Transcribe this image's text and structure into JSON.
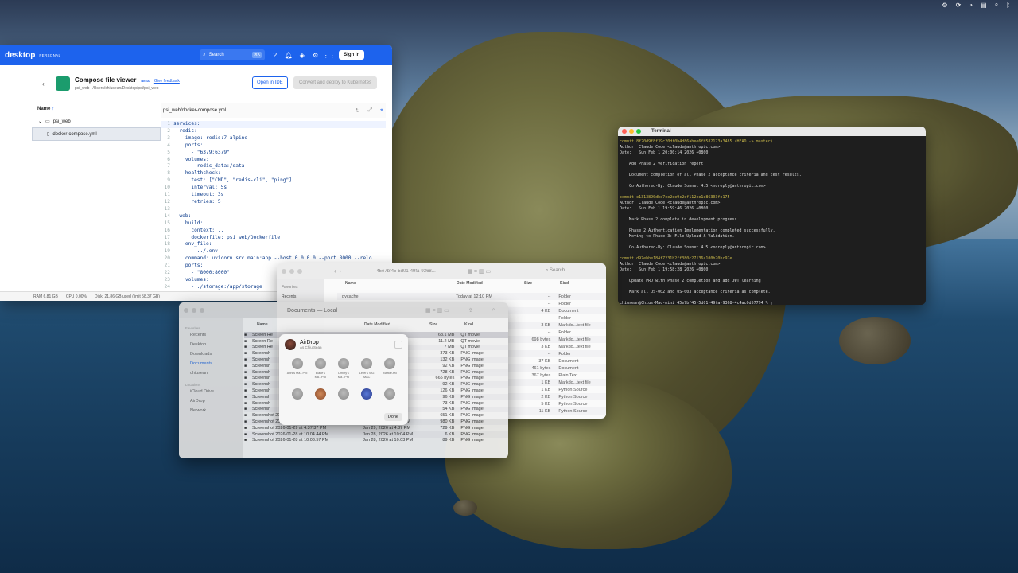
{
  "menubar": {
    "icons": [
      "gear-icon",
      "sync-icon",
      "wifi-icon",
      "control-center-icon",
      "search-icon",
      "bluetooth-icon"
    ]
  },
  "docker": {
    "brand": "desktop",
    "plan": "PERSONAL",
    "search_placeholder": "Search",
    "search_kbd": "⌘K",
    "signin_label": "Sign in",
    "page_title": "Compose file viewer",
    "beta": "BETA",
    "feedback": "Give feedback",
    "path": "psi_web | /Users/chiusean/Desktop/psi/psi_web",
    "open_ide": "Open in IDE",
    "deploy": "Convert and deploy to Kubernetes",
    "tree_header": "Name",
    "tree_folder": "psi_web",
    "tree_file": "docker-compose.yml",
    "editor_path": "psi_web/docker-compose.yml",
    "status": {
      "ram": "RAM 6.81 GB",
      "cpu": "CPU 0.00%",
      "disk": "Disk: 21.86 GB used (limit 58.37 GB)"
    },
    "code": [
      {
        "n": "1",
        "t": "services:"
      },
      {
        "n": "2",
        "t": "  redis:"
      },
      {
        "n": "3",
        "t": "    image: redis:7-alpine"
      },
      {
        "n": "4",
        "t": "    ports:"
      },
      {
        "n": "5",
        "t": "      - \"6379:6379\""
      },
      {
        "n": "6",
        "t": "    volumes:"
      },
      {
        "n": "7",
        "t": "      - redis_data:/data"
      },
      {
        "n": "8",
        "t": "    healthcheck:"
      },
      {
        "n": "9",
        "t": "      test: [\"CMD\", \"redis-cli\", \"ping\"]"
      },
      {
        "n": "10",
        "t": "      interval: 5s"
      },
      {
        "n": "11",
        "t": "      timeout: 3s"
      },
      {
        "n": "12",
        "t": "      retries: 5"
      },
      {
        "n": "13",
        "t": ""
      },
      {
        "n": "14",
        "t": "  web:"
      },
      {
        "n": "15",
        "t": "    build:"
      },
      {
        "n": "16",
        "t": "      context: .."
      },
      {
        "n": "17",
        "t": "      dockerfile: psi_web/Dockerfile"
      },
      {
        "n": "18",
        "t": "    env_file:"
      },
      {
        "n": "19",
        "t": "      - ../.env"
      },
      {
        "n": "20",
        "t": "    command: uvicorn src.main:app --host 0.0.0.0 --port 8000 --relo"
      },
      {
        "n": "21",
        "t": "    ports:"
      },
      {
        "n": "22",
        "t": "      - \"8000:8000\""
      },
      {
        "n": "23",
        "t": "    volumes:"
      },
      {
        "n": "24",
        "t": "      - ./storage:/app/storage"
      }
    ]
  },
  "terminal": {
    "title": "Terminal",
    "lines": [
      {
        "t": "commit 8f20d9f8f39c20df0b4d86abee6fb582123a3485 (HEAD -> master)",
        "c": "commit"
      },
      {
        "t": "Author: Claude Code <claude@anthropic.com>",
        "c": ""
      },
      {
        "t": "Date:   Sun Feb 1 20:00:14 2026 +0800",
        "c": ""
      },
      {
        "t": "",
        "c": ""
      },
      {
        "t": "    Add Phase 2 verification report",
        "c": ""
      },
      {
        "t": "",
        "c": ""
      },
      {
        "t": "    Document completion of all Phase 2 acceptance criteria and test results.",
        "c": ""
      },
      {
        "t": "",
        "c": ""
      },
      {
        "t": "    Co-Authored-By: Claude Sonnet 4.5 <noreply@anthropic.com>",
        "c": ""
      },
      {
        "t": "",
        "c": ""
      },
      {
        "t": "commit e1313890dbe7ee2ee9c2ef112ee1e86303fe175",
        "c": "commit"
      },
      {
        "t": "Author: Claude Code <claude@anthropic.com>",
        "c": ""
      },
      {
        "t": "Date:   Sun Feb 1 19:59:46 2026 +0800",
        "c": ""
      },
      {
        "t": "",
        "c": ""
      },
      {
        "t": "    Mark Phase 2 complete in development progress",
        "c": ""
      },
      {
        "t": "",
        "c": ""
      },
      {
        "t": "    Phase 2 Authentication Implementation completed successfully.",
        "c": ""
      },
      {
        "t": "    Moving to Phase 3: File Upload & Validation.",
        "c": ""
      },
      {
        "t": "",
        "c": ""
      },
      {
        "t": "    Co-Authored-By: Claude Sonnet 4.5 <noreply@anthropic.com>",
        "c": ""
      },
      {
        "t": "",
        "c": ""
      },
      {
        "t": "commit d97ebbe184f7231b2ff380c27136a100b20bc97e",
        "c": "commit"
      },
      {
        "t": "Author: Claude Code <claude@anthropic.com>",
        "c": ""
      },
      {
        "t": "Date:   Sun Feb 1 19:58:28 2026 +0800",
        "c": ""
      },
      {
        "t": "",
        "c": ""
      },
      {
        "t": "    Update PRD with Phase 2 completion and add JWT learning",
        "c": ""
      },
      {
        "t": "",
        "c": ""
      },
      {
        "t": "    Mark all US-002 and US-003 acceptance criteria as complete.",
        "c": ""
      },
      {
        "t": "",
        "c": ""
      },
      {
        "t": "chiusean@Chius-Mac-mini 45e7bf45-5d01-49fa-9368-4c4ac0d57794 % ▯",
        "c": ""
      }
    ]
  },
  "finder_back": {
    "title": "45e7bf45-5d01-49fa-9368...",
    "search": "Search",
    "sidebar": [
      "Favorites",
      "Recents"
    ],
    "columns": [
      "Name",
      "Date Modified",
      "Size",
      "Kind"
    ],
    "rows": [
      {
        "name": "__pycache__",
        "date": "Today at 12:10 PM",
        "size": "--",
        "kind": "Folder"
      },
      {
        "name": "",
        "date": "",
        "size": "--",
        "kind": "Folder"
      },
      {
        "name": "",
        "date": "",
        "size": "4 KB",
        "kind": "Document"
      },
      {
        "name": "",
        "date": "",
        "size": "--",
        "kind": "Folder"
      },
      {
        "name": "",
        "date": "",
        "size": "3 KB",
        "kind": "Markdo...text file"
      },
      {
        "name": "",
        "date": "",
        "size": "--",
        "kind": "Folder"
      },
      {
        "name": "",
        "date": "",
        "size": "698 bytes",
        "kind": "Markdo...text file"
      },
      {
        "name": "",
        "date": "",
        "size": "3 KB",
        "kind": "Markdo...text file"
      },
      {
        "name": "",
        "date": "",
        "size": "--",
        "kind": "Folder"
      },
      {
        "name": "",
        "date": "",
        "size": "37 KB",
        "kind": "Document"
      },
      {
        "name": "",
        "date": "",
        "size": "461 bytes",
        "kind": "Document"
      },
      {
        "name": "",
        "date": "",
        "size": "367 bytes",
        "kind": "Plain Text"
      },
      {
        "name": "",
        "date": "",
        "size": "1 KB",
        "kind": "Markdo...text file"
      },
      {
        "name": "",
        "date": "",
        "size": "1 KB",
        "kind": "Python Source"
      },
      {
        "name": "",
        "date": "",
        "size": "2 KB",
        "kind": "Python Source"
      },
      {
        "name": "",
        "date": "",
        "size": "5 KB",
        "kind": "Python Source"
      },
      {
        "name": "",
        "date": "",
        "size": "11 KB",
        "kind": "Python Source"
      }
    ]
  },
  "finder_front": {
    "title": "Documents — Local",
    "sidebar": {
      "favorites_label": "Favorites",
      "favorites": [
        "Recents",
        "Desktop",
        "Downloads",
        "Documents",
        "chiusean"
      ],
      "locations_label": "Locations",
      "locations": [
        "iCloud Drive",
        "AirDrop",
        "Network"
      ]
    },
    "columns": [
      "Name",
      "Date Modified",
      "Size",
      "Kind"
    ],
    "rows": [
      {
        "name": "Screen Re",
        "date": "",
        "size": "63.1 MB",
        "kind": "QT movie"
      },
      {
        "name": "Screen Re",
        "date": "",
        "size": "11.2 MB",
        "kind": "QT movie"
      },
      {
        "name": "Screen Re",
        "date": "",
        "size": "7 MB",
        "kind": "QT movie"
      },
      {
        "name": "Screensh",
        "date": "",
        "size": "373 KB",
        "kind": "PNG image"
      },
      {
        "name": "Screensh",
        "date": "",
        "size": "132 KB",
        "kind": "PNG image"
      },
      {
        "name": "Screensh",
        "date": "",
        "size": "92 KB",
        "kind": "PNG image"
      },
      {
        "name": "Screensh",
        "date": "",
        "size": "728 KB",
        "kind": "PNG image"
      },
      {
        "name": "Screensh",
        "date": "",
        "size": "665 bytes",
        "kind": "PNG image"
      },
      {
        "name": "Screensh",
        "date": "",
        "size": "92 KB",
        "kind": "PNG image"
      },
      {
        "name": "Screensh",
        "date": "",
        "size": "126 KB",
        "kind": "PNG image"
      },
      {
        "name": "Screensh",
        "date": "",
        "size": "96 KB",
        "kind": "PNG image"
      },
      {
        "name": "Screensh",
        "date": "",
        "size": "73 KB",
        "kind": "PNG image"
      },
      {
        "name": "Screensh",
        "date": "",
        "size": "54 KB",
        "kind": "PNG image"
      },
      {
        "name": "Screenshot 2026-01-31 at 2.46.05 PM",
        "date": "Yesterday at 2:46 PM",
        "size": "651 KB",
        "kind": "PNG image"
      },
      {
        "name": "Screenshot 2026-01-29 at 8.18.54 PM",
        "date": "Jan 29, 2026 at 8:19 PM",
        "size": "980 KB",
        "kind": "PNG image"
      },
      {
        "name": "Screenshot 2026-01-29 at 4.37.37 PM",
        "date": "Jan 29, 2026 at 4:37 PM",
        "size": "729 KB",
        "kind": "PNG image"
      },
      {
        "name": "Screenshot 2026-01-28 at 10.04.44 PM",
        "date": "Jan 28, 2026 at 10:04 PM",
        "size": "6 KB",
        "kind": "PNG image"
      },
      {
        "name": "Screenshot 2026-01-28 at 10.03.57 PM",
        "date": "Jan 28, 2026 at 10:03 PM",
        "size": "89 KB",
        "kind": "PNG image"
      }
    ]
  },
  "airdrop": {
    "title": "AirDrop",
    "subtitle": "As Chiu Sean",
    "devices": [
      "Abhi's Ma...Pro",
      "Blake's Ma...Pro",
      "Dmitry's Ma...Pro",
      "Lerel's SIG MAC",
      "Markie-tec"
    ],
    "done": "Done"
  }
}
